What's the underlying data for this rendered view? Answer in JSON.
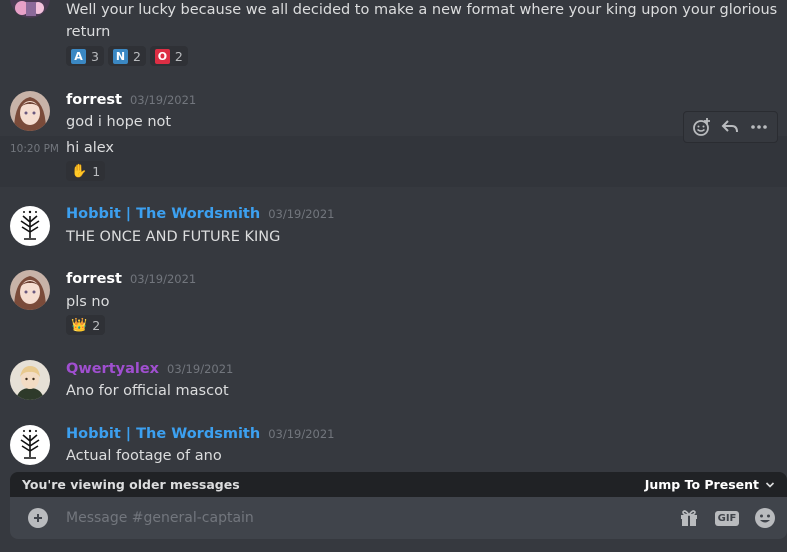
{
  "channel": {
    "placeholder": "Message #general-captain"
  },
  "colors": {
    "user_forrest": "#ffffff",
    "user_hobbit": "#3ca0f0",
    "user_qwerty": "#a04fd0",
    "reaction_a": "#3b88c3",
    "reaction_n": "#3b88c3",
    "reaction_o": "#dd2e44"
  },
  "messages": [
    {
      "content_line1": "Well your lucky because we all decided to make a new format where your king upon your glorious",
      "content_line2": "return",
      "reactions": [
        {
          "letter": "A",
          "count": "3"
        },
        {
          "letter": "N",
          "count": "2"
        },
        {
          "letter": "O",
          "count": "2"
        }
      ]
    },
    {
      "username": "forrest",
      "timestamp": "03/19/2021",
      "content": "god i hope not",
      "followup_time": "10:20 PM",
      "followup_content": "hi alex",
      "reactions": [
        {
          "emoji": "✋",
          "icon": "raised-hand-icon",
          "count": "1"
        }
      ]
    },
    {
      "username": "Hobbit | The Wordsmith",
      "timestamp": "03/19/2021",
      "content": "THE ONCE AND FUTURE KING"
    },
    {
      "username": "forrest",
      "timestamp": "03/19/2021",
      "content": "pls no",
      "reactions": [
        {
          "emoji": "👑",
          "icon": "crown-icon",
          "count": "2"
        }
      ]
    },
    {
      "username": "Qwertyalex",
      "timestamp": "03/19/2021",
      "content": "Ano for official mascot"
    },
    {
      "username": "Hobbit | The Wordsmith",
      "timestamp": "03/19/2021",
      "content": "Actual footage of ano"
    }
  ],
  "older_bar": {
    "text": "You're viewing older messages",
    "jump_label": "Jump To Present"
  },
  "composer": {
    "gif_label": "GIF"
  }
}
